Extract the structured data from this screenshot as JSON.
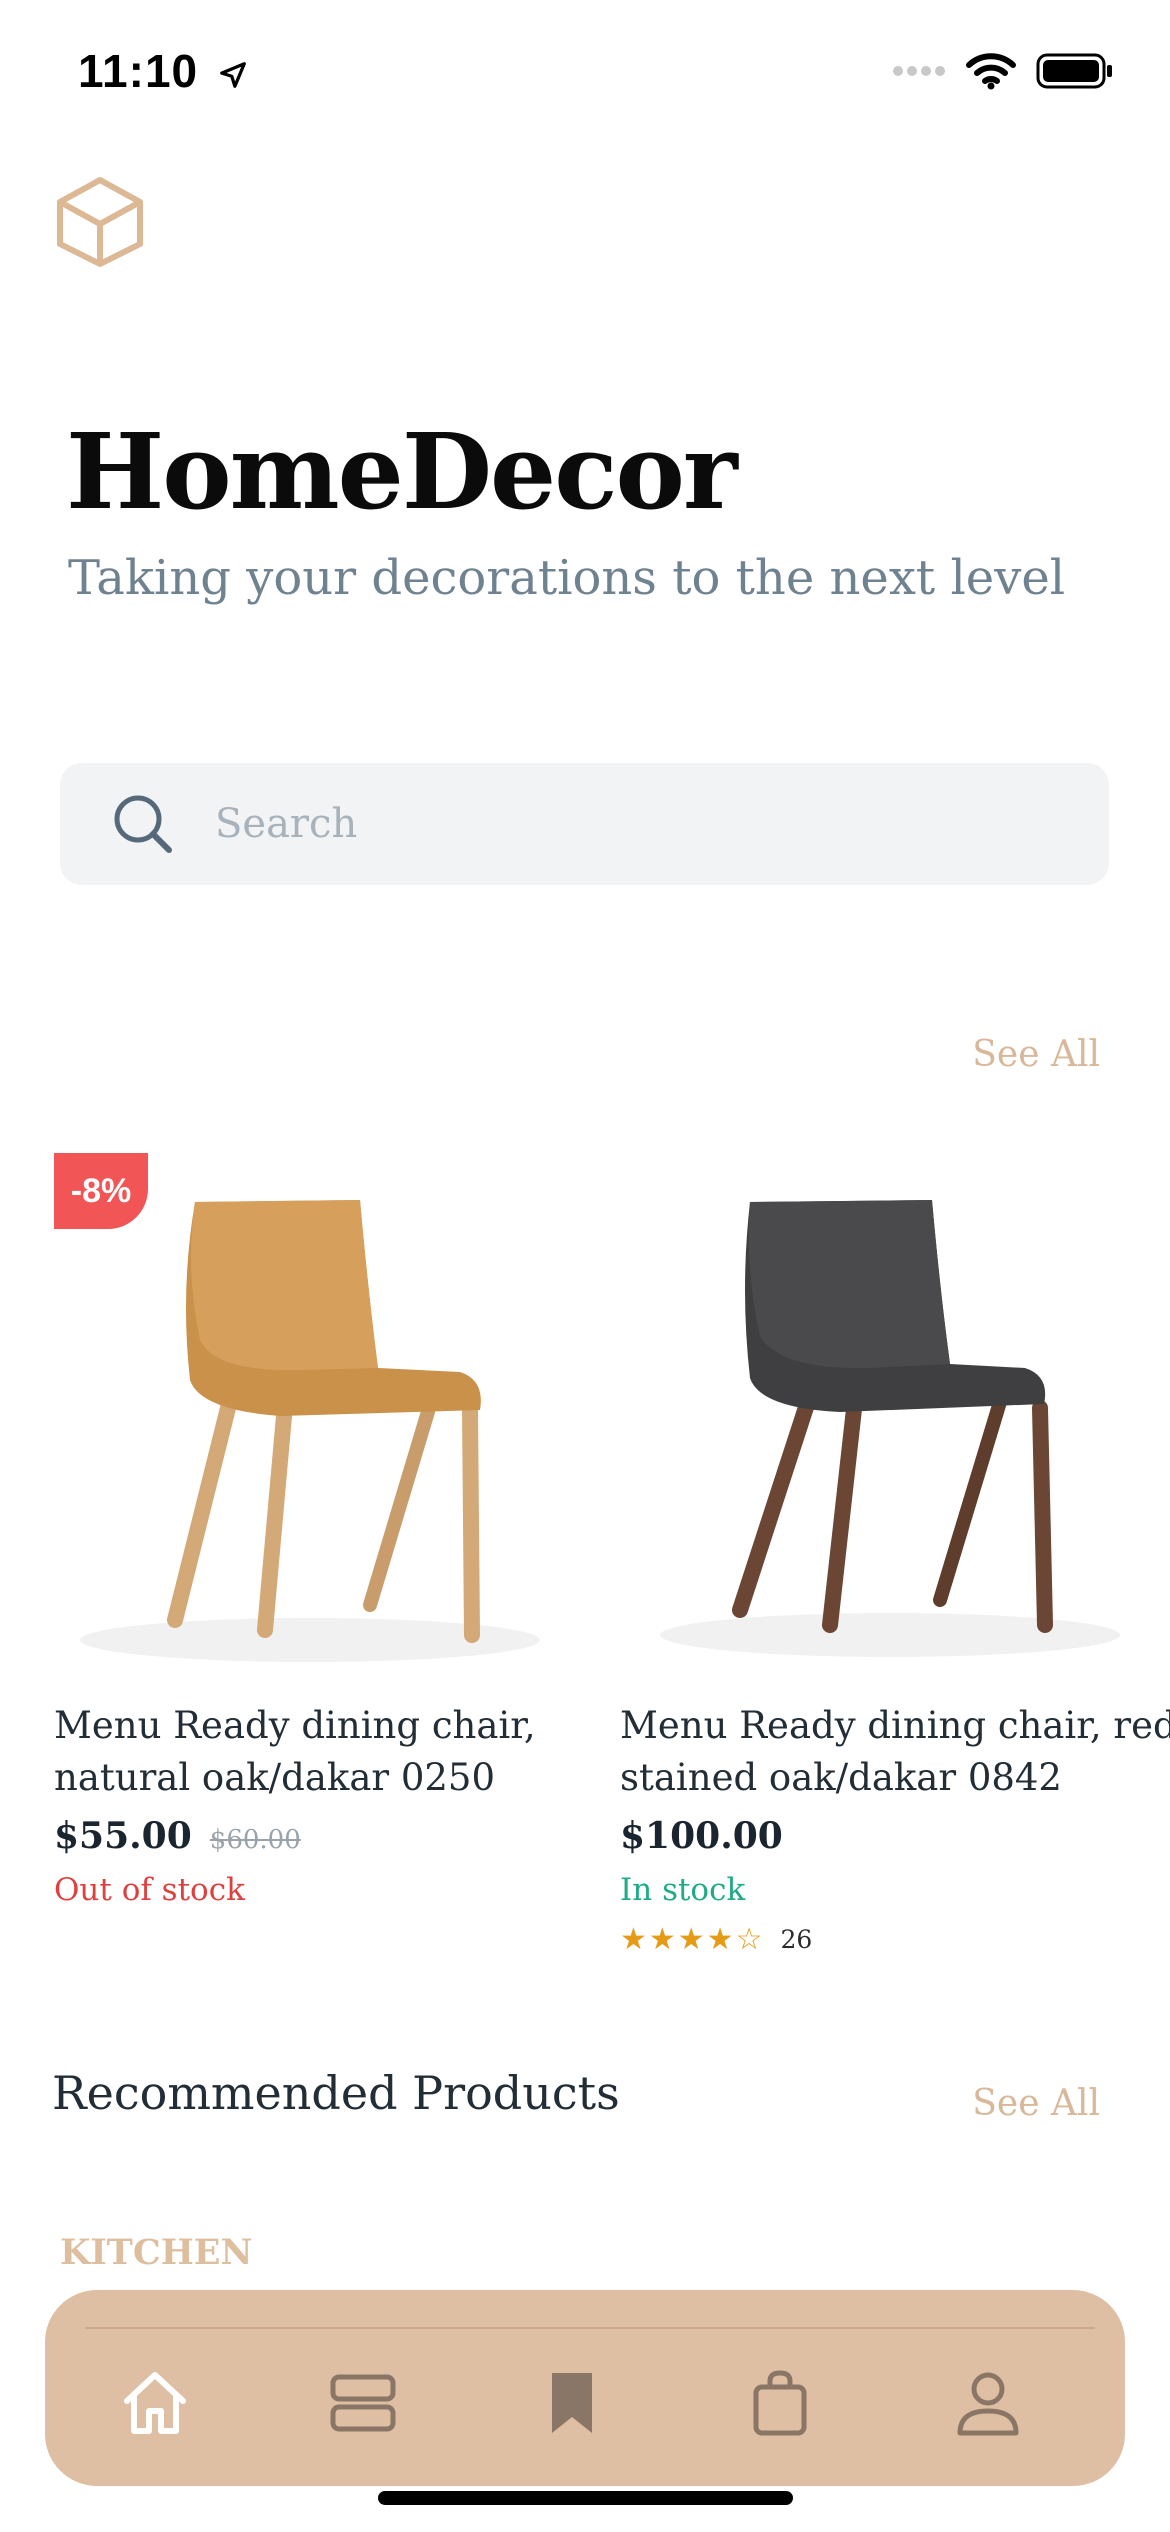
{
  "status_bar": {
    "time": "11:10"
  },
  "header": {
    "logo_icon": "cube-icon",
    "title": "HomeDecor",
    "subtitle": "Taking your decorations to the next level"
  },
  "search": {
    "placeholder": "Search",
    "value": ""
  },
  "featured": {
    "see_all_label": "See All",
    "products": [
      {
        "name_line1": "Menu Ready dining chair,",
        "name_line2": "natural oak/dakar 0250",
        "price": "$55.00",
        "old_price": "$60.00",
        "discount_badge": "-8%",
        "stock_status": "Out of stock",
        "seat_color": "#c9914a",
        "frame_color": "#d4a978"
      },
      {
        "name_line1": "Menu Ready dining chair, red",
        "name_line2": "stained oak/dakar 0842",
        "price": "$100.00",
        "stock_status": "In stock",
        "rating": 4,
        "rating_max": 5,
        "rating_count": "26",
        "seat_color": "#3f3f41",
        "frame_color": "#6b4634"
      }
    ]
  },
  "recommended": {
    "title": "Recommended Products",
    "see_all_label": "See All",
    "category": "KITCHEN"
  },
  "tab_bar": {
    "items": [
      {
        "icon": "home-icon",
        "active": true
      },
      {
        "icon": "categories-icon",
        "active": false
      },
      {
        "icon": "bookmark-icon",
        "active": false
      },
      {
        "icon": "shopping-bag-icon",
        "active": false
      },
      {
        "icon": "profile-icon",
        "active": false
      }
    ]
  },
  "colors": {
    "accent": "#dfbfa3",
    "sale_badge": "#f15555",
    "in_stock": "#1fab88",
    "out_of_stock": "#e0403d",
    "star": "#e69b16"
  }
}
